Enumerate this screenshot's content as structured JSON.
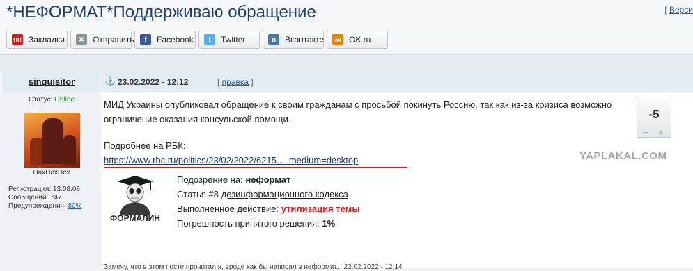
{
  "page": {
    "title": "*НЕФОРМАТ*Поддерживаю обращение",
    "version_prefix": "[",
    "version_link": "Верси"
  },
  "share_bar": [
    {
      "label": "Закладки",
      "icon": "yandex-bookmarks-icon",
      "icon_glyph": "ЯП",
      "color": "#d41f1f"
    },
    {
      "label": "Отправить",
      "icon": "envelope-icon",
      "icon_glyph": "✉",
      "color": "#8b929a"
    },
    {
      "label": "Facebook",
      "icon": "facebook-icon",
      "icon_glyph": "f",
      "color": "#3b5998"
    },
    {
      "label": "Twitter",
      "icon": "twitter-icon",
      "icon_glyph": "t",
      "color": "#55acee"
    },
    {
      "label": "Вконтакте",
      "icon": "vk-icon",
      "icon_glyph": "в",
      "color": "#4a76a8"
    },
    {
      "label": "OK.ru",
      "icon": "ok-icon",
      "icon_glyph": "ок",
      "color": "#ee8208"
    }
  ],
  "post": {
    "author": "sinquisitor",
    "date": "23.02.2022 - 12:12",
    "edit_label": "правка",
    "status_label": "Статус:",
    "status_value": "Online",
    "avatar_caption": "НахПохНех",
    "stats": {
      "registration": "Регистрация: 13.08.08",
      "messages": "Сообщений: 747",
      "warnings_label": "Предупреждения:",
      "warnings_value": "80%"
    },
    "text": "МИД Украины опубликовал обращение к своим гражданам с просьбой покинуть Россию, так как из-за кризиса возможно ограничение оказания консульской помощи.",
    "more_label": "Подробнее на РБК:",
    "more_link": "https://www.rbc.ru/politics/23/02/2022/6215..._medium=desktop",
    "rating": "-5",
    "rating_minus": "−",
    "rating_plus": "+"
  },
  "moderation": {
    "label": "ФОРМАЛИН",
    "suspicion_label": "Подозрение на:",
    "suspicion_value": "неформат",
    "article_prefix": "Статья #8",
    "article_link": "дезинформационного кодекса",
    "action_label": "Выполненное действие:",
    "action_value": "утилизация темы",
    "error_label": "Погрешность принятого решения:",
    "error_value": "1%"
  },
  "cut_text": "Замечу, что в этом посте прочитал я, вроде как бы написал в неформат... 23.02.2022 - 12:14",
  "watermark": "YAPLAKAL.COM"
}
